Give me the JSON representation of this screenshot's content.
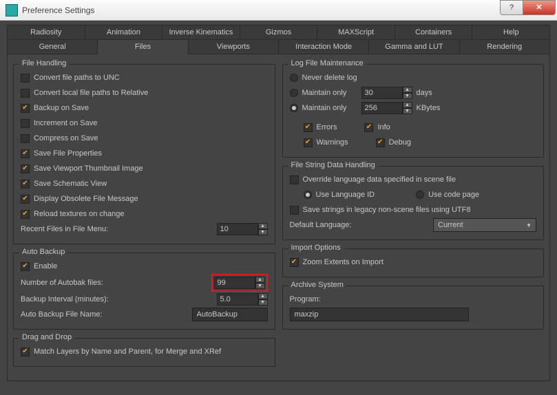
{
  "window": {
    "title": "Preference Settings"
  },
  "tabs_row1": [
    "Radiosity",
    "Animation",
    "Inverse Kinematics",
    "Gizmos",
    "MAXScript",
    "Containers",
    "Help"
  ],
  "tabs_row2": [
    "General",
    "Files",
    "Viewports",
    "Interaction Mode",
    "Gamma and LUT",
    "Rendering"
  ],
  "active_tab": "Files",
  "file_handling": {
    "legend": "File Handling",
    "convert_unc": "Convert file paths to UNC",
    "convert_relative": "Convert local file paths to Relative",
    "backup_on_save": "Backup on Save",
    "increment_on_save": "Increment on Save",
    "compress_on_save": "Compress on Save",
    "save_file_props": "Save File Properties",
    "save_vp_thumb": "Save Viewport Thumbnail Image",
    "save_schematic": "Save Schematic View",
    "obsolete_msg": "Display Obsolete File Message",
    "reload_textures": "Reload textures on change",
    "recent_label": "Recent Files in File Menu:",
    "recent_value": "10"
  },
  "auto_backup": {
    "legend": "Auto Backup",
    "enable": "Enable",
    "num_label": "Number of Autobak files:",
    "num_value": "99",
    "interval_label": "Backup Interval (minutes):",
    "interval_value": "5.0",
    "name_label": "Auto Backup File Name:",
    "name_value": "AutoBackup"
  },
  "drag_drop": {
    "legend": "Drag and Drop",
    "match_layers": "Match Layers by Name and Parent, for Merge and XRef"
  },
  "log_maint": {
    "legend": "Log File Maintenance",
    "never_delete": "Never delete log",
    "maintain_only": "Maintain only",
    "days_value": "30",
    "days_unit": "days",
    "kb_value": "256",
    "kb_unit": "KBytes",
    "errors": "Errors",
    "info": "Info",
    "warnings": "Warnings",
    "debug": "Debug"
  },
  "file_string": {
    "legend": "File String Data Handling",
    "override": "Override language data specified in scene file",
    "use_lang_id": "Use Language ID",
    "use_code_page": "Use code page",
    "save_utf8": "Save strings in legacy non-scene files using UTF8",
    "default_lang_label": "Default Language:",
    "default_lang_value": "Current"
  },
  "import_opts": {
    "legend": "Import Options",
    "zoom_extents": "Zoom Extents on Import"
  },
  "archive": {
    "legend": "Archive System",
    "program_label": "Program:",
    "program_value": "maxzip"
  }
}
